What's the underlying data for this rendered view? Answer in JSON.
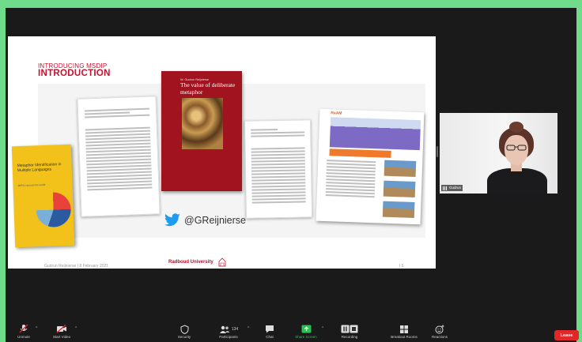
{
  "slide": {
    "kicker": "INTRODUCING MSDIP",
    "title": "INTRODUCTION",
    "footer_left": "Gudrun Reijnierse | 8 February 2021",
    "footer_center": "Radboud University",
    "footer_right": "| 5",
    "twitter_handle": "@GReijnierse",
    "book_yellow_title": "Metaphor Identification in Multiple Languages",
    "book_yellow_subtitle": "MIPVU around the world",
    "book_red_author": "W. Gudrun Reijnierse",
    "book_red_title": "The value of deliberate metaphor",
    "doc_orange_logo": "RaAM"
  },
  "gallery": {
    "participant_name": "Gudrun"
  },
  "toolbar": {
    "unmute": "Unmute",
    "start_video": "Start Video",
    "security": "Security",
    "participants": "Participants",
    "participants_count": "134",
    "chat": "Chat",
    "share_screen": "Share Screen",
    "recording": "Recording",
    "reactions": "Reactions",
    "breakout": "Breakout Rooms",
    "leave": "Leave"
  },
  "colors": {
    "accent_red": "#c8102e",
    "share_green": "#2fbd55",
    "leave_red": "#e02828",
    "frame_green": "#6fdc8c"
  }
}
